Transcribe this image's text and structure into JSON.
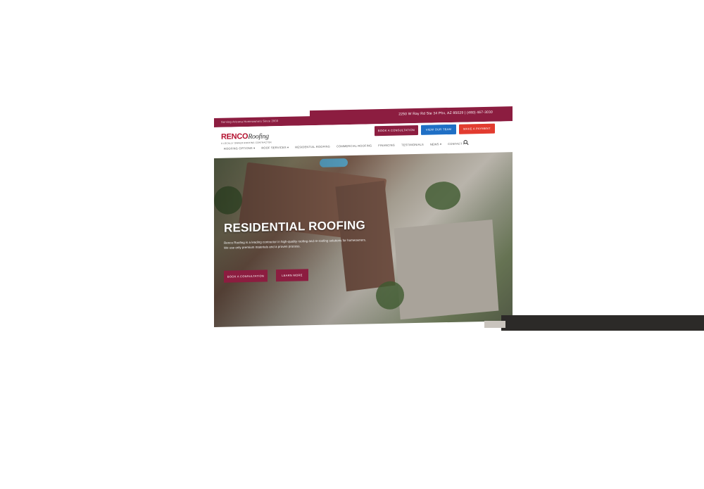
{
  "topbar": {
    "left_text": "Serving Arizona Homeowners Since 2003",
    "right_text": "2250 W Ray Rd Ste 34 Phx, AZ 85029 | (480) 467-3030"
  },
  "header": {
    "logo_brand": "RENCO",
    "logo_brand_suffix": "Roofing",
    "logo_tagline": "A LOCALLY OWNED ROOFING CONTRACTOR",
    "buttons": [
      "BOOK A CONSULTATION",
      "VIEW OUR TEAM",
      "MAKE A PAYMENT"
    ]
  },
  "nav": {
    "items": [
      "ROOFING OPTIONS ▾",
      "ROOF SERVICES ▾",
      "RESIDENTIAL ROOFING",
      "COMMERCIAL ROOFING",
      "FINANCING",
      "TESTIMONIALS",
      "NEWS ▾",
      "CONTACT ▾"
    ]
  },
  "hero": {
    "title": "RESIDENTIAL ROOFING",
    "description": "Renco Roofing is a leading contractor in high-quality roofing and re-roofing solutions for homeowners. We use only premium materials and a proven process.",
    "cta_primary": "BOOK A CONSULTATION",
    "cta_secondary": "LEARN MORE"
  },
  "colors": {
    "brand": "#8c1d40",
    "blue": "#1f6fc5",
    "red": "#e23b2f"
  },
  "icons": {
    "search": "search-icon"
  }
}
